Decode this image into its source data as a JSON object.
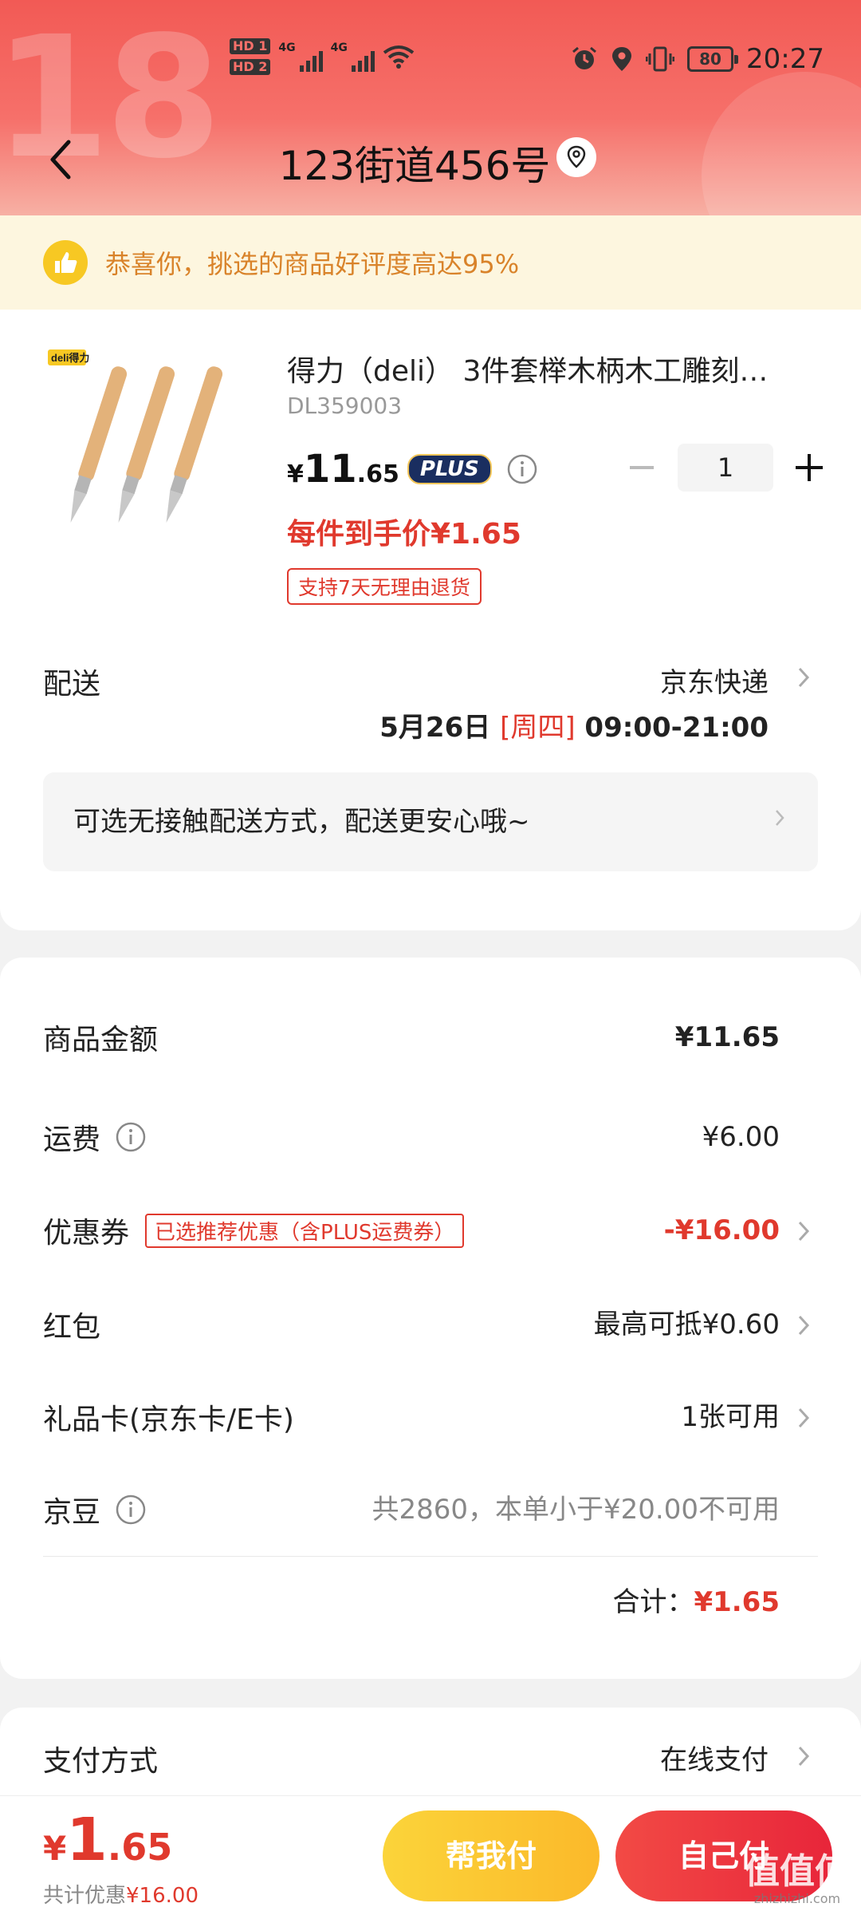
{
  "status_bar": {
    "hd1": "HD 1",
    "hd2": "HD 2",
    "net1": "4G",
    "net2": "4G",
    "battery": "80",
    "time": "20:27"
  },
  "header": {
    "title": "123街道456号",
    "bg_number": "18"
  },
  "banner": {
    "text": "恭喜你，挑选的商品好评度高达95%"
  },
  "product": {
    "name": "得力（deli） 3件套榉木柄木工雕刻…",
    "sku": "DL359003",
    "price_symbol": "¥",
    "price_int": "11",
    "price_dec": ".65",
    "plus_badge": "PLUS",
    "quantity": "1",
    "unit_price": "每件到手价¥1.65",
    "return_tag": "支持7天无理由退货"
  },
  "shipping": {
    "label": "配送",
    "carrier": "京东快递",
    "date": "5月26日 ",
    "weekday": "[周四]",
    "time": " 09:00-21:00",
    "contactless": "可选无接触配送方式，配送更安心哦~"
  },
  "summary": {
    "goods_label": "商品金额",
    "goods_value": "¥11.65",
    "freight_label": "运费",
    "freight_value": "¥6.00",
    "coupon_label": "优惠券",
    "coupon_tag": "已选推荐优惠（含PLUS运费券）",
    "coupon_value": "-¥16.00",
    "redpacket_label": "红包",
    "redpacket_value": "最高可抵¥0.60",
    "giftcard_label": "礼品卡(京东卡/E卡)",
    "giftcard_value": "1张可用",
    "beans_label": "京豆",
    "beans_value": "共2860，本单小于¥20.00不可用",
    "total_label": "合计：",
    "total_value": "¥1.65"
  },
  "payment": {
    "label": "支付方式",
    "value": "在线支付"
  },
  "bottom_bar": {
    "sym": "¥",
    "int": "1",
    "dec": ".65",
    "saving_label": "共计优惠",
    "saving_value": "¥16.00",
    "help_pay": "帮我付",
    "self_pay": "自己付",
    "watermark": "值值值",
    "watermark_sub": "zhizhizhi.com"
  },
  "colors": {
    "accent_red": "#e0392d",
    "header_red": "#f25a55",
    "yellow_button": "#fbd43a",
    "plus_navy": "#1a2e60"
  }
}
